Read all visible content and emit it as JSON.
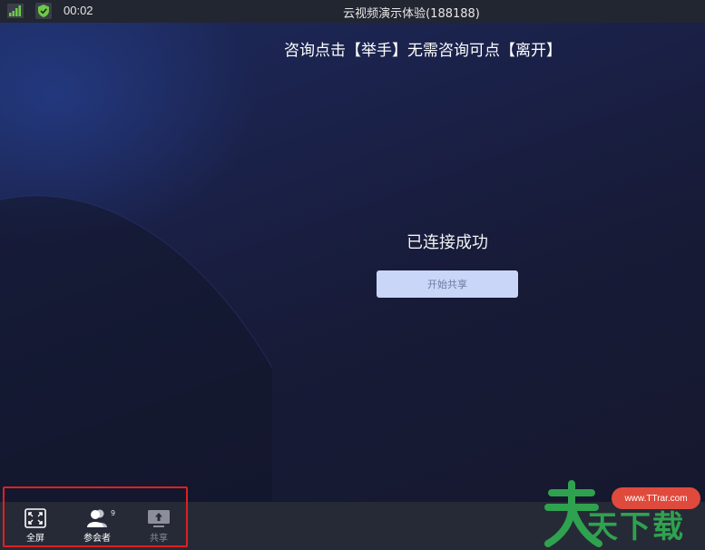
{
  "topbar": {
    "timer": "00:02",
    "title": "云视频演示体验(188188)",
    "icons": [
      "signal-icon",
      "shield-check-icon"
    ]
  },
  "stage": {
    "notice": "咨询点击【举手】无需咨询可点【离开】",
    "status": "已连接成功",
    "share_button": "开始共享"
  },
  "toolbar": {
    "fullscreen_label": "全屏",
    "participants_label": "参会者",
    "participants_count": "9",
    "share_label": "共享"
  },
  "watermark": {
    "url": "www.TTrar.com",
    "text_left": "天",
    "text_right": "天下载"
  },
  "colors": {
    "accent_button": "#c9d6f7",
    "highlight_border": "#e02020",
    "watermark_green": "#2fa24f",
    "watermark_red": "#e04a3c"
  }
}
